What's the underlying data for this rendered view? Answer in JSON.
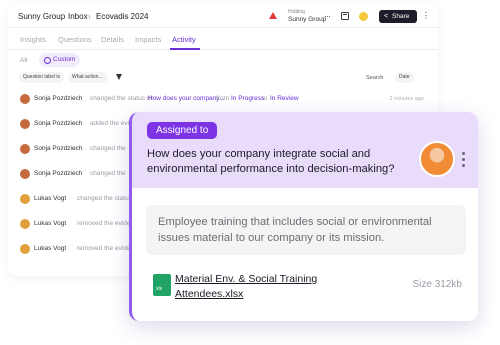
{
  "breadcrumb": {
    "org": "Sunny Group",
    "section": "Inbox",
    "item": "Ecovadis 2024",
    "sep": "›"
  },
  "header": {
    "holding_label": "Holding",
    "holding_name": "Sunny Group",
    "share_label": "Share",
    "more": "···",
    "kebab": "⋮"
  },
  "tabs": [
    "Insights",
    "Questions",
    "Details",
    "Impacts",
    "Activity"
  ],
  "active_tab": "Activity",
  "filters": {
    "all_label": "All",
    "custom_label": "Custom",
    "chip_question": "Question label is",
    "chip_value": "What action...",
    "search_label": "Search",
    "date_chip": "Date"
  },
  "activity": [
    {
      "who": "Sonja Pozdziech",
      "action": "changed the status of",
      "link": "How does your company...",
      "from_label": "from",
      "from": "In Progress",
      "to_label": "to",
      "to": "In Review",
      "time": "2 minutes ago"
    },
    {
      "who": "Sonja Pozdziech",
      "action": "added the evidence"
    },
    {
      "who": "Sonja Pozdziech",
      "action": "changed the"
    },
    {
      "who": "Sonja Pozdziech",
      "action": "changed the"
    },
    {
      "who": "Lukas Vogt",
      "action": "changed the status of"
    },
    {
      "who": "Lukas Vogt",
      "action": "removed the evidence"
    },
    {
      "who": "Lukas Vogt",
      "action": "removed the evidence"
    }
  ],
  "card": {
    "badge": "Assigned to",
    "question": "How does your company integrate social and environmental performance into decision-making?",
    "answer": "Employee training that includes social or environmental issues material to our company or its mission.",
    "file_name": "Material Env. & Social Training Attendees.xlsx",
    "file_size": "Size 312kb"
  },
  "colors": {
    "accent": "#7d33e6",
    "card_header": "#e9dcfb",
    "excel": "#21a366",
    "warning": "#e03a3a"
  }
}
